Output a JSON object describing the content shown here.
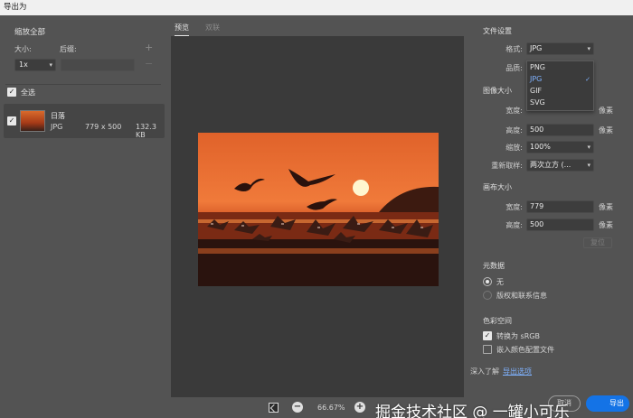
{
  "window": {
    "title": "导出为"
  },
  "left": {
    "scale_all": "缩放全部",
    "size_label": "大小:",
    "suffix_label": "后缀:",
    "size_value": "1x",
    "suffix_value": "",
    "select_all_label": "全选",
    "assets": [
      {
        "name": "日落",
        "format": "JPG",
        "dimensions": "779 x 500",
        "filesize": "132.3 KB"
      }
    ]
  },
  "center": {
    "tabs": [
      {
        "label": "预览"
      },
      {
        "label": "双联"
      }
    ],
    "zoom": "66.67%"
  },
  "right": {
    "file_settings": {
      "title": "文件设置",
      "format_label": "格式:",
      "format_value": "JPG",
      "quality_label": "品质:",
      "format_options": [
        "PNG",
        "JPG",
        "GIF",
        "SVG"
      ],
      "selected_option": "JPG"
    },
    "image_size": {
      "title": "图像大小",
      "width_label": "宽度:",
      "height_label": "高度:",
      "height_value": "500",
      "scale_label": "缩放:",
      "scale_value": "100%",
      "resample_label": "重新取样:",
      "resample_value": "两次立方 (...",
      "unit": "像素"
    },
    "canvas_size": {
      "title": "画布大小",
      "width_label": "宽度:",
      "width_value": "779",
      "height_label": "高度:",
      "height_value": "500",
      "unit": "像素",
      "reset_label": "复位"
    },
    "metadata": {
      "title": "元数据",
      "options": [
        "无",
        "版权和联系信息"
      ],
      "selected": "无"
    },
    "color_space": {
      "title": "色彩空间",
      "convert_label": "转换为 sRGB",
      "embed_label": "嵌入颜色配置文件"
    },
    "learn_more_label": "深入了解",
    "learn_more_link": "导出选项",
    "cancel_label": "取消",
    "export_label": "导出"
  },
  "watermark": "掘金技术社区 @ 一罐小可乐",
  "colors": {
    "accent": "#1473e6",
    "panel_bg": "#535353",
    "canvas_bg": "#3a3a3a"
  }
}
